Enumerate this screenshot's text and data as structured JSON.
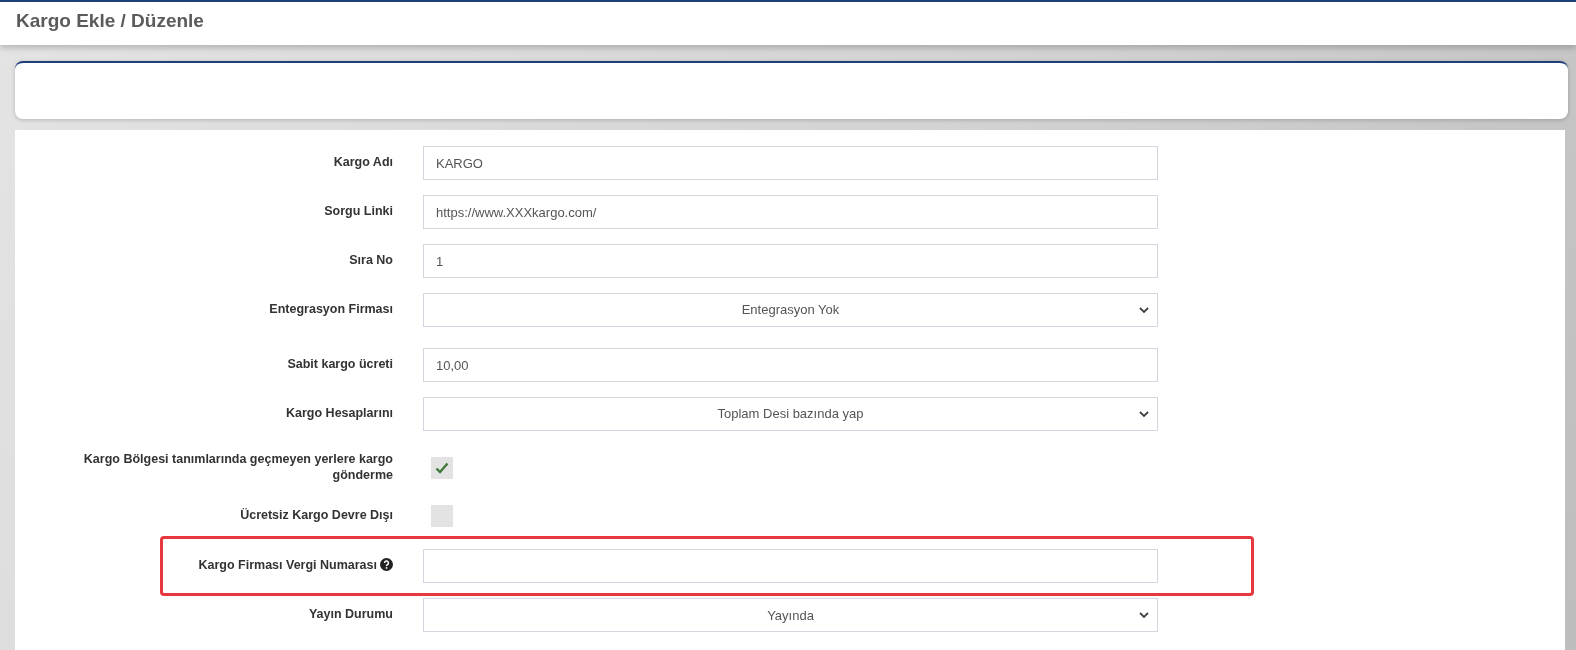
{
  "page_title": "Kargo Ekle / Düzenle",
  "form": {
    "rows": [
      {
        "kind": "text",
        "label": "Kargo Adı",
        "value": "KARGO"
      },
      {
        "kind": "text",
        "label": "Sorgu Linki",
        "value": "https://www.XXXkargo.com/"
      },
      {
        "kind": "text",
        "label": "Sıra No",
        "value": "1"
      },
      {
        "kind": "select",
        "label": "Entegrasyon Firması",
        "value": "Entegrasyon Yok"
      },
      {
        "kind": "text",
        "label": "Sabit kargo ücreti",
        "value": "10,00"
      },
      {
        "kind": "select",
        "label": "Kargo Hesaplarını",
        "value": "Toplam Desi bazında yap"
      },
      {
        "kind": "checkbox",
        "label": "Kargo Bölgesi tanımlarında geçmeyen yerlere kargo gönderme",
        "checked": true
      },
      {
        "kind": "checkbox",
        "label": "Ücretsiz Kargo Devre Dışı",
        "checked": false
      },
      {
        "kind": "text",
        "label": "Kargo Firması Vergi Numarası",
        "value": "",
        "help": true,
        "highlighted": true
      },
      {
        "kind": "select",
        "label": "Yayın Durumu",
        "value": "Yayında"
      }
    ]
  }
}
